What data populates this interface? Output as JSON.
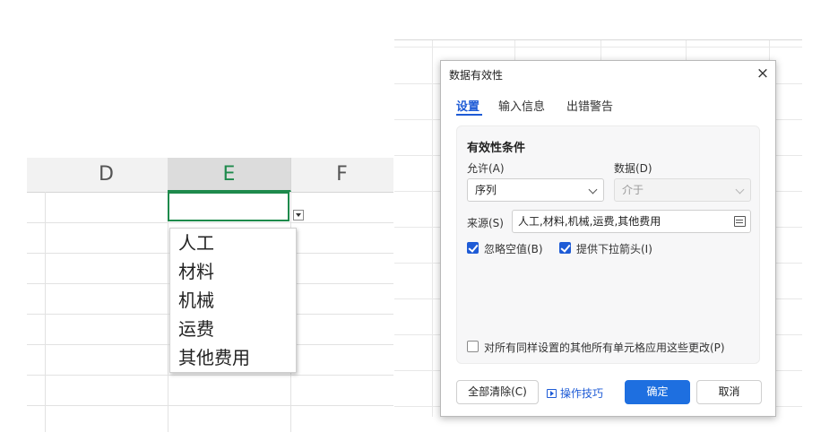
{
  "sheet": {
    "columns": [
      "D",
      "E",
      "F"
    ],
    "selected_column": "E",
    "dropdown_items": [
      "人工",
      "材料",
      "机械",
      "运费",
      "其他费用"
    ]
  },
  "dialog": {
    "title": "数据有效性",
    "close": "×",
    "tabs": [
      "设置",
      "输入信息",
      "出错警告"
    ],
    "active_tab": "设置",
    "section_title": "有效性条件",
    "allow_label": "允许(A)",
    "allow_value": "序列",
    "data_label": "数据(D)",
    "data_value": "介于",
    "source_label": "来源(S)",
    "source_value": "人工,材料,机械,运费,其他费用",
    "ignore_blank_label": "忽略空值(B)",
    "ignore_blank_checked": true,
    "dropdown_arrow_label": "提供下拉箭头(I)",
    "dropdown_arrow_checked": true,
    "apply_all_label": "对所有同样设置的其他所有单元格应用这些更改(P)",
    "apply_all_checked": false,
    "clear_all": "全部清除(C)",
    "tips": "操作技巧",
    "ok": "确定",
    "cancel": "取消"
  },
  "colors": {
    "accent_green": "#1e8a4c",
    "primary_blue": "#1e6fe0",
    "link_blue": "#1e5bd6"
  }
}
